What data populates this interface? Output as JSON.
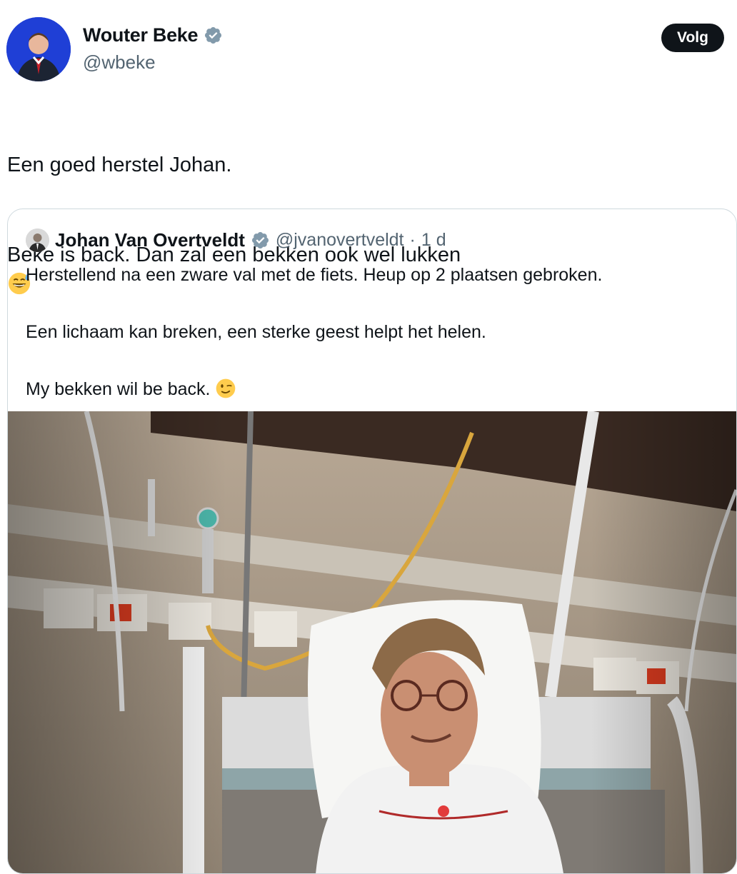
{
  "author": {
    "name": "Wouter Beke",
    "handle": "@wbeke",
    "verified": true,
    "avatar_icon": "profile-photo"
  },
  "follow_label": "Volg",
  "tweet": {
    "lines": [
      "Een goed herstel Johan.",
      "Beke is back. Dan zal een bekken ook wel lukken"
    ],
    "emoji": "grinning-face-with-sweat-icon"
  },
  "quote": {
    "name": "Johan Van Overtveldt",
    "handle": "@jvanovertveldt",
    "separator": "·",
    "time": "1 d",
    "verified": true,
    "paragraphs": [
      "Herstellend na een zware val met de fiets. Heup op 2 plaatsen gebroken.",
      "Een lichaam kan breken, een sterke geest helpt het helen.",
      "My bekken wil be back."
    ],
    "emoji": "winking-face-icon"
  },
  "colors": {
    "text": "#0f1419",
    "secondary": "#536471",
    "verified_badge": "#829aab",
    "border": "#cfd9de",
    "follow_bg": "#0f1419",
    "avatar_bg": "#1f3fd6"
  }
}
